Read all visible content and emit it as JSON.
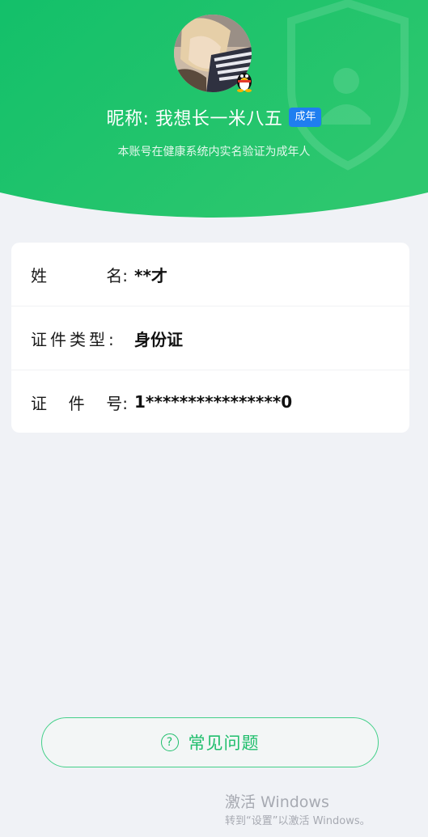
{
  "profile": {
    "nickname": "昵称: 我想长一米八五",
    "age_badge": "成年",
    "verification_note": "本账号在健康系统内实名验证为成年人",
    "avatar_icon": "user-avatar",
    "badge_icon": "qq-penguin-icon"
  },
  "identity": {
    "name_label_chars": [
      "姓",
      "名:"
    ],
    "name_value": "**才",
    "id_type_label": "证件类型:",
    "id_type_value": "身份证",
    "id_number_label_chars": [
      "证",
      "件",
      "号:"
    ],
    "id_number_value": "1****************0"
  },
  "faq": {
    "icon": "question-circle-icon",
    "icon_glyph": "?",
    "label": "常见问题"
  },
  "watermark": {
    "title": "激活 Windows",
    "subtitle": "转到“设置”以激活 Windows。"
  },
  "colors": {
    "header_green": "#1dc267",
    "accent_green": "#1fbe6c",
    "badge_blue": "#1f7ef0",
    "page_bg": "#f0f2f6"
  }
}
